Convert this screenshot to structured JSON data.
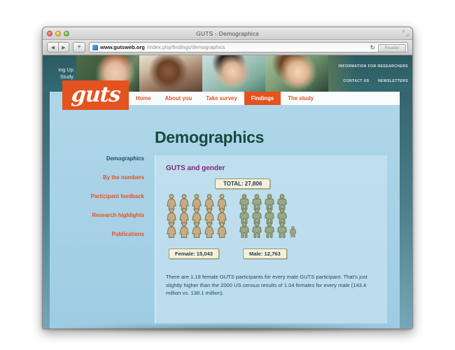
{
  "browser": {
    "window_title": "GUTS - Demographics",
    "url_strong": "www.gutsweb.org",
    "url_dim": "/index.php/findings/demographics",
    "back_glyph": "◀",
    "forward_glyph": "▶",
    "add_tab_glyph": "+",
    "reload_glyph": "↻",
    "reader_label": "Reader",
    "traffic_lights": [
      "close",
      "minimize",
      "zoom"
    ]
  },
  "site": {
    "study_name_line1": "ing Up",
    "study_name_line2": "Study",
    "logo_text": "guts",
    "top_links": [
      "INFORMATION FOR RESEARCHERS",
      "CONTACT US",
      "NEWSLETTERS"
    ],
    "nav": [
      {
        "label": "Home",
        "active": false
      },
      {
        "label": "About you",
        "active": false
      },
      {
        "label": "Take survey",
        "active": false
      },
      {
        "label": "Findings",
        "active": true
      },
      {
        "label": "The study",
        "active": false
      }
    ]
  },
  "main": {
    "page_title": "Demographics",
    "sidebar": [
      {
        "label": "Demographics",
        "active": true
      },
      {
        "label": "By the numbers",
        "active": false
      },
      {
        "label": "Participant feedback",
        "active": false
      },
      {
        "label": "Research highlights",
        "active": false
      },
      {
        "label": "Publications",
        "active": false
      }
    ],
    "panel_title": "GUTS and gender",
    "body_text": "There are 1.18 female GUTS participants for every male GUTS participant. That's just slightly higher than the 2000 US census results of 1.04 females for every male (143.4 million vs. 138.1 million)."
  },
  "chart_data": {
    "type": "pictogram",
    "title": "GUTS and gender",
    "total_label": "TOTAL: 27,806",
    "total_value": 27806,
    "categories": [
      "Female",
      "Male"
    ],
    "values": [
      15043,
      12763
    ],
    "labels": [
      "Female: 15,043",
      "Male: 12,763"
    ],
    "unit_per_icon": 1000,
    "icons": {
      "female_full": 15,
      "male_full": 12,
      "male_partial": 1
    },
    "female_color": "#cda981",
    "male_color": "#9aa884",
    "icon_outline": "#6f7f5a",
    "legend_position": "below",
    "annotations": [
      "1.18 female participants for every male participant",
      "2000 US census: 1.04 females per male (143.4 million vs. 138.1 million)"
    ]
  },
  "colors": {
    "brand_orange": "#e4521f",
    "title_green": "#17493f",
    "panel_purple": "#7a2a7a",
    "teal_dark": "#2d5a61",
    "page_blue": "#a9d2e6",
    "label_cream": "#f4f0dc",
    "label_border": "#9b9a5f",
    "text_blue": "#1d4a5e"
  }
}
